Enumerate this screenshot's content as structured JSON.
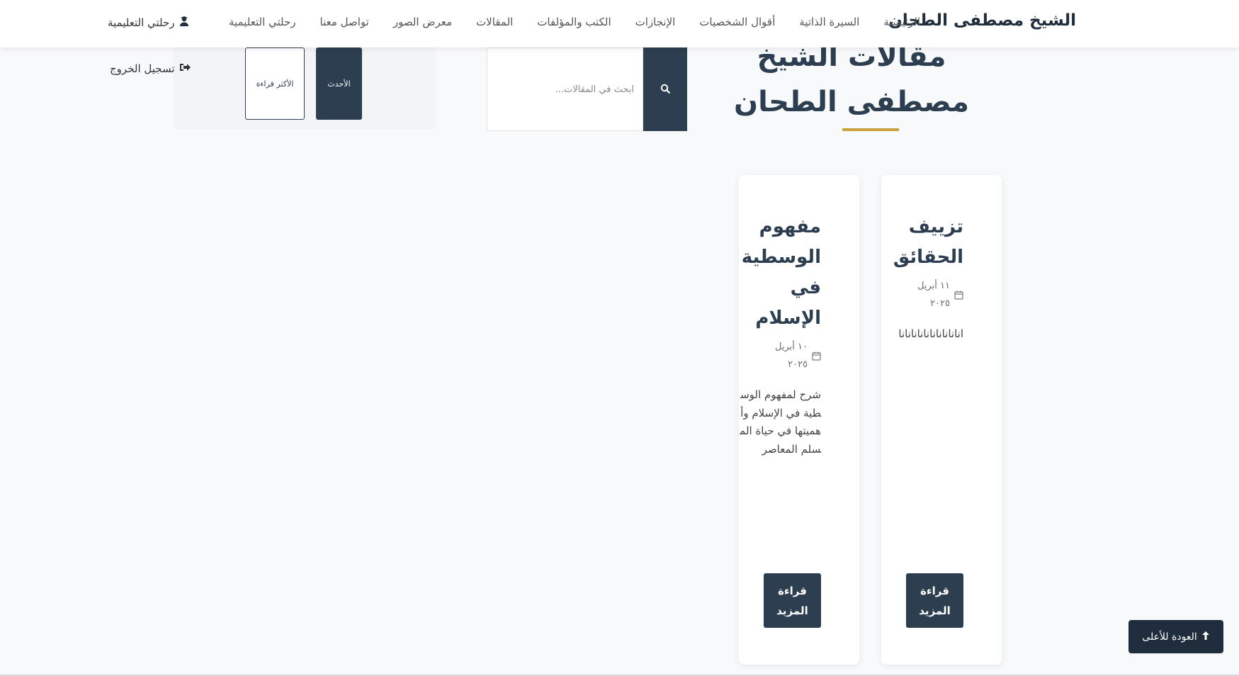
{
  "navbar": {
    "brand": "الشيخ مصطفى الطحان",
    "links": [
      "الرئيسية",
      "السيرة الذاتية",
      "أقوال الشخصيات",
      "الإنجازات",
      "الكتب والمؤلفات",
      "المقالات",
      "معرض الصور",
      "تواصل معنا",
      "رحلتي التعليمية"
    ],
    "user_link": "رحلتي التعليمية",
    "user_icon": "user-graduate-icon"
  },
  "page": {
    "title_line1": "مقالات الشيخ",
    "title_line2": "مصطفى الطحان",
    "accent_color": "#c9a13b",
    "primary_color": "#2c3e50"
  },
  "search": {
    "placeholder": "ابحث في المقالات...",
    "button_icon": "search-icon"
  },
  "sort": {
    "latest_label": "الأحدث",
    "popular_label": "الأكثر قراءة"
  },
  "logout": {
    "label": "تسجيل الخروج",
    "icon": "sign-out-icon"
  },
  "articles": [
    {
      "title": "تزييف الحقائق",
      "date": "١١ أبريل ٢٠٢٥",
      "excerpt": "انانانانانانانانانانا",
      "button_label": "قراءة المزيد"
    },
    {
      "title": "مفهوم الوسطية في الإسلام",
      "date": "١٠ أبريل ٢٠٢٥",
      "excerpt": "شرح لمفهوم الوسطية في الإسلام وأهميتها في حياة المسلم المعاصر",
      "button_label": "قراءة المزيد"
    }
  ],
  "back_to_top": {
    "label": "العودة للأعلى",
    "icon": "arrow-up-icon"
  }
}
